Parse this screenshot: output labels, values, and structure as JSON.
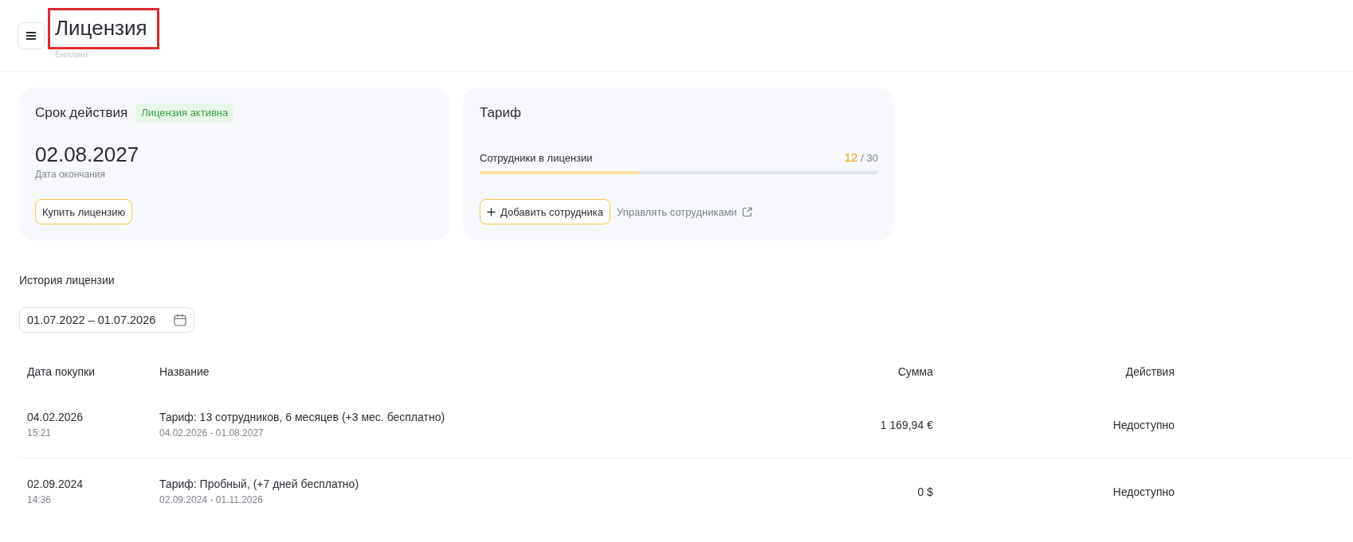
{
  "header": {
    "title": "Лицензия",
    "highlighted": true,
    "subtitle": "Биллинг"
  },
  "validity_card": {
    "title": "Срок действия",
    "status_badge": {
      "label": "Лицензия активна",
      "active": true
    },
    "end_date": "02.08.2027",
    "end_date_label": "Дата окончания",
    "buy_button": "Купить лицензию"
  },
  "tariff_card": {
    "title": "Тариф",
    "employees": {
      "label": "Сотрудники в лицензии",
      "used": "12",
      "total": "/ 30",
      "level": 0.4
    },
    "add_button": "Добавить сотрудника",
    "manage_link": "Управлять сотрудниками"
  },
  "history": {
    "title": "История лицензии",
    "date_range": {
      "value": "01.07.2022 – 01.07.2026"
    },
    "table": {
      "columns": [
        "Дата покупки",
        "Название",
        "Сумма",
        "Действия"
      ],
      "rows": [
        {
          "date": "04.02.2026",
          "time": "15:21",
          "name": "Тариф: 13 сотрудников, 6 месяцев (+3 мес. бесплатно)",
          "period": "04.02.2026 - 01.08.2027",
          "amount": "1 169,94 €",
          "action": "Недоступно"
        },
        {
          "date": "02.09.2024",
          "time": "14:36",
          "name": "Тариф: Пробный, (+7 дней бесплатно)",
          "period": "02.09.2024 - 01.11.2026",
          "amount": "0 $",
          "action": "Недоступно"
        }
      ]
    }
  }
}
